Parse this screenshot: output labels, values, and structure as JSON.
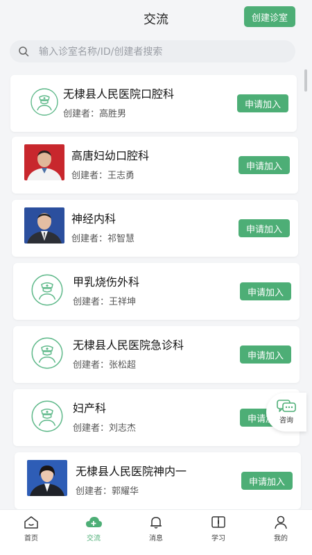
{
  "header": {
    "title": "交流",
    "create_label": "创建诊室"
  },
  "search": {
    "placeholder": "输入诊室名称/ID/创建者搜索"
  },
  "join_label": "申请加入",
  "creator_prefix": "创建者：",
  "rooms": [
    {
      "name": "无棣县人民医院口腔科",
      "creator": "高胜男",
      "avatar": "doctor-icon"
    },
    {
      "name": "高唐妇幼口腔科",
      "creator": "王志勇",
      "avatar": "photo-male-white-coat"
    },
    {
      "name": "神经内科",
      "creator": "祁智慧",
      "avatar": "photo-male-suit"
    },
    {
      "name": "甲乳烧伤外科",
      "creator": "王祥坤",
      "avatar": "doctor-icon"
    },
    {
      "name": "无棣县人民医院急诊科",
      "creator": "张松超",
      "avatar": "doctor-icon"
    },
    {
      "name": "妇产科",
      "creator": "刘志杰",
      "avatar": "doctor-icon"
    },
    {
      "name": "无棣县人民医院神内一",
      "creator": "郭耀华",
      "avatar": "photo-female-suit"
    }
  ],
  "consult": {
    "label": "咨询"
  },
  "tabs": [
    {
      "label": "首页",
      "icon": "home-icon"
    },
    {
      "label": "交流",
      "icon": "cloud-plus-icon",
      "active": true
    },
    {
      "label": "消息",
      "icon": "bell-icon"
    },
    {
      "label": "学习",
      "icon": "book-icon"
    },
    {
      "label": "我的",
      "icon": "user-icon"
    }
  ],
  "colors": {
    "accent": "#4dae76",
    "background": "#f4f5f7"
  }
}
